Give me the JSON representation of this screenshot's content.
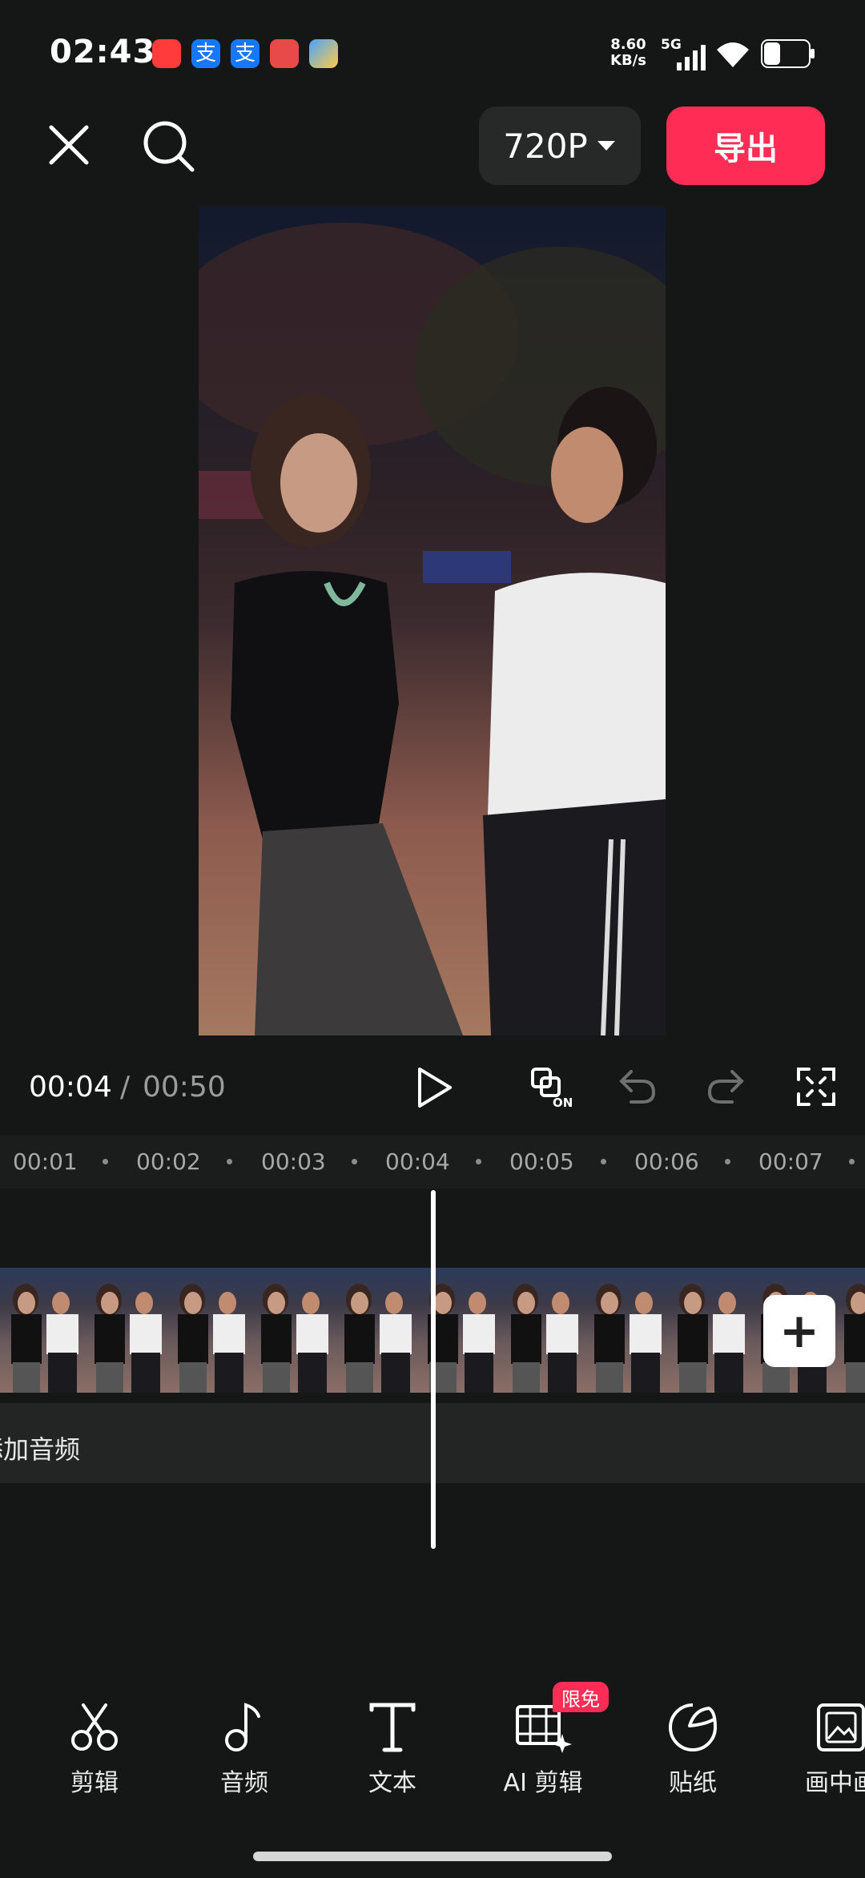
{
  "status_bar": {
    "time": "02:43",
    "net_speed_value": "8.60",
    "net_speed_unit": "KB/s",
    "net_type": "5G",
    "app_icons": [
      "xiaohongshu-icon",
      "alipay-icon",
      "alipay-icon",
      "huawei-health-icon",
      "weather-icon"
    ]
  },
  "top_bar": {
    "resolution": "720P",
    "export_label": "导出"
  },
  "player": {
    "current_time": "00:04",
    "separator": "/",
    "total_time": "00:50"
  },
  "ruler": {
    "ticks": [
      "00:01",
      "00:02",
      "00:03",
      "00:04",
      "00:05",
      "00:06",
      "00:07"
    ]
  },
  "tracks": {
    "audio_label": "添加音频"
  },
  "toolbar": {
    "items": [
      {
        "label": "剪辑",
        "icon": "scissors-icon"
      },
      {
        "label": "音频",
        "icon": "music-note-icon"
      },
      {
        "label": "文本",
        "icon": "text-icon"
      },
      {
        "label": "AI 剪辑",
        "icon": "ai-edit-icon",
        "badge": "限免"
      },
      {
        "label": "贴纸",
        "icon": "sticker-icon"
      },
      {
        "label": "画中画",
        "icon": "picture-in-picture-icon"
      }
    ]
  },
  "colors": {
    "background": "#151716",
    "accent": "#ff2d55"
  }
}
